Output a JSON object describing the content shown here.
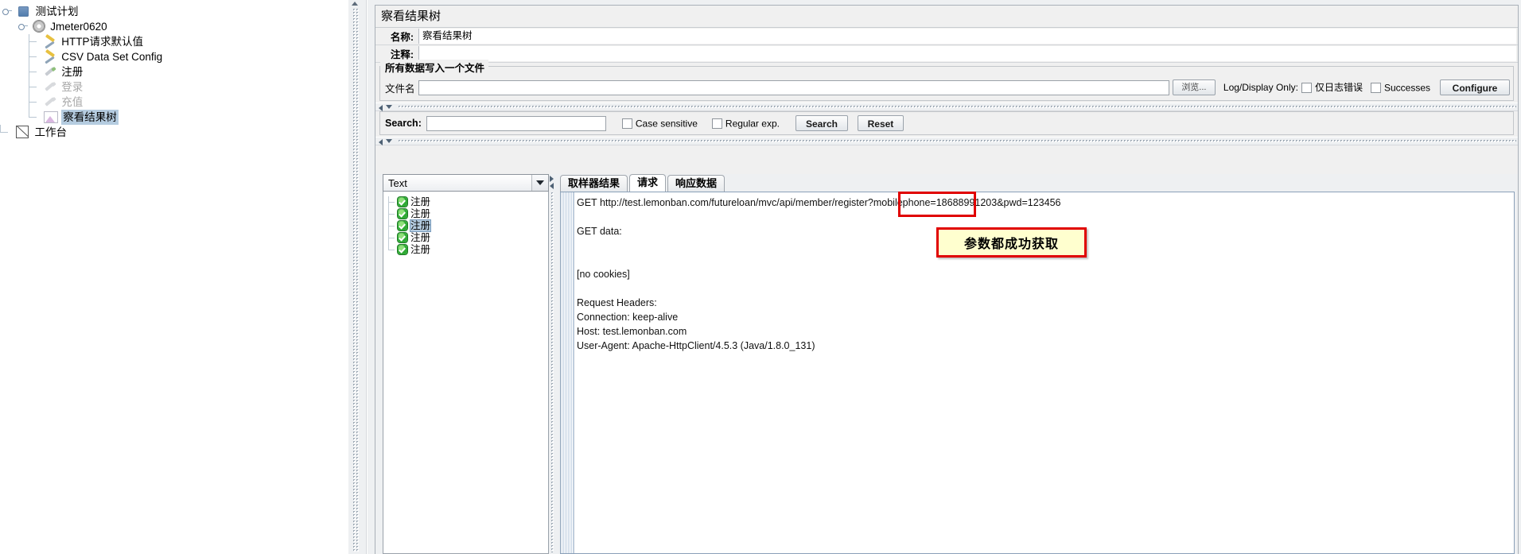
{
  "tree": {
    "nodes": [
      {
        "label": "测试计划",
        "icon": "test-plan-icon",
        "depth": 0,
        "state": "normal",
        "expander": true
      },
      {
        "label": "Jmeter0620",
        "icon": "thread-group-icon",
        "depth": 1,
        "state": "normal",
        "expander": true
      },
      {
        "label": "HTTP请求默认值",
        "icon": "config-wrench-icon",
        "depth": 2,
        "state": "normal",
        "expander": false
      },
      {
        "label": "CSV Data Set Config",
        "icon": "config-wrench-icon",
        "depth": 2,
        "state": "normal",
        "expander": false
      },
      {
        "label": "注册",
        "icon": "http-sampler-icon",
        "depth": 2,
        "state": "normal",
        "expander": false
      },
      {
        "label": "登录",
        "icon": "http-sampler-icon",
        "depth": 2,
        "state": "disabled",
        "expander": false
      },
      {
        "label": "充值",
        "icon": "http-sampler-icon",
        "depth": 2,
        "state": "disabled",
        "expander": false
      },
      {
        "label": "察看结果树",
        "icon": "view-results-tree-icon",
        "depth": 2,
        "state": "selected",
        "expander": false
      },
      {
        "label": "工作台",
        "icon": "workbench-icon",
        "depth": 0,
        "state": "normal",
        "expander": false
      }
    ]
  },
  "panel": {
    "title": "察看结果树",
    "name_label": "名称:",
    "name_value": "察看结果树",
    "comment_label": "注释:",
    "comment_value": "",
    "filegroup": {
      "title": "所有数据写入一个文件",
      "filename_label": "文件名",
      "filename_value": "",
      "browse_button": "浏览...",
      "log_display_only_label": "Log/Display Only:",
      "errors_checkbox": "仅日志错误",
      "errors_checked": false,
      "successes_checkbox": "Successes",
      "successes_checked": false,
      "configure_button": "Configure"
    },
    "search": {
      "label": "Search:",
      "value": "",
      "case_sensitive_label": "Case sensitive",
      "case_sensitive_checked": false,
      "regular_exp_label": "Regular exp.",
      "regular_exp_checked": false,
      "search_button": "Search",
      "reset_button": "Reset"
    },
    "renderer": {
      "selected": "Text"
    },
    "results_list": [
      {
        "label": "注册",
        "status": "ok",
        "selected": false
      },
      {
        "label": "注册",
        "status": "ok",
        "selected": false
      },
      {
        "label": "注册",
        "status": "ok",
        "selected": true
      },
      {
        "label": "注册",
        "status": "ok",
        "selected": false
      },
      {
        "label": "注册",
        "status": "ok",
        "selected": false
      }
    ],
    "tabs": [
      {
        "label": "取样器结果",
        "active": false
      },
      {
        "label": "请求",
        "active": true
      },
      {
        "label": "响应数据",
        "active": false
      }
    ],
    "request_text": "GET http://test.lemonban.com/futureloan/mvc/api/member/register?mobilephone=18688991203&pwd=123456\n\nGET data:\n\n\n[no cookies]\n\nRequest Headers:\nConnection: keep-alive\nHost: test.lemonban.com\nUser-Agent: Apache-HttpClient/4.5.3 (Java/1.8.0_131)"
  },
  "annotations": {
    "highlight_box_target": "mobilephone=18688991203",
    "note_text": "参数都成功获取",
    "note_bg": "#ffffcf",
    "note_border": "#e00000",
    "highlight_border": "#e00000"
  }
}
